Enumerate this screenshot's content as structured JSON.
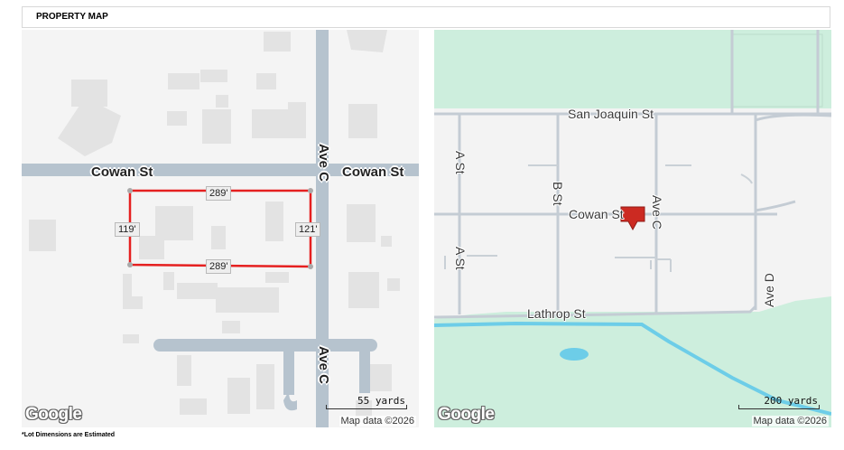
{
  "header": {
    "title": "PROPERTY MAP"
  },
  "left_map": {
    "streets": {
      "horizontal": "Cowan St",
      "vertical": "Ave C"
    },
    "lot_dimensions": {
      "top": "289'",
      "bottom": "289'",
      "left": "119'",
      "right": "121'"
    },
    "scale_label": "55 yards",
    "attribution": "Map data ©2026",
    "logo": "Google",
    "colors": {
      "lot_outline": "#e52020",
      "road": "#b5c2cd",
      "building": "#e4e4e4"
    }
  },
  "right_map": {
    "streets": {
      "san_joaquin": "San Joaquin St",
      "cowan": "Cowan St",
      "lathrop": "Lathrop St",
      "a_st": "A St",
      "b_st": "B St",
      "ave_c": "Ave C",
      "ave_d": "Ave D"
    },
    "scale_label": "200 yards",
    "attribution": "Map data ©2026",
    "logo": "Google",
    "marker_icon": "location-pin",
    "colors": {
      "park": "#cdeedd",
      "water": "#6dcde8",
      "marker": "#cc2a22"
    }
  },
  "footnote": "*Lot Dimensions are Estimated"
}
